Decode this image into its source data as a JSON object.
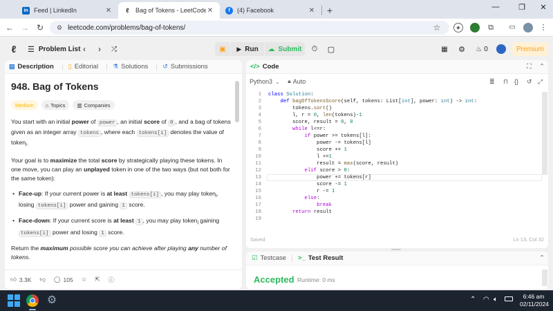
{
  "browser": {
    "tabs": [
      {
        "title": "Feed | LinkedIn",
        "favicon": "linkedin-icon",
        "color": "#0a66c2"
      },
      {
        "title": "Bag of Tokens - LeetCode",
        "favicon": "leetcode-icon",
        "color": "#ffa116"
      },
      {
        "title": "(4) Facebook",
        "favicon": "facebook-icon",
        "color": "#1877f2"
      }
    ],
    "url": "leetcode.com/problems/bag-of-tokens/"
  },
  "header": {
    "problem_list": "Problem List",
    "run": "Run",
    "submit": "Submit",
    "streak": "0",
    "premium": "Premium"
  },
  "left": {
    "tabs": [
      "Description",
      "Editorial",
      "Solutions",
      "Submissions"
    ],
    "title": "948. Bag of Tokens",
    "badges": [
      "Medium",
      "Topics",
      "Companies"
    ],
    "para1": {
      "a": "You start with an initial ",
      "b": "power",
      "c": " of ",
      "d": "power",
      "e": ", an initial ",
      "f": "score",
      "g": " of ",
      "h": "0",
      "i": ", and a bag of tokens given as an integer array ",
      "j": "tokens",
      "k": ", where each ",
      "l": "tokens[i]",
      "m": " denotes the value of token",
      "n": "i",
      "o": "."
    },
    "para2": {
      "a": "Your goal is to ",
      "b": "maximize",
      "c": " the total ",
      "d": "score",
      "e": " by strategically playing these tokens. In one move, you can play an ",
      "f": "unplayed",
      "g": " token in one of the two ways (but not both for the same token):"
    },
    "bullet1": {
      "a": "Face-up",
      "b": ": If your current power is ",
      "c": "at least",
      "d": " ",
      "e": "tokens[i]",
      "f": ", you may play token",
      "g": "i",
      "h": ", losing ",
      "i": "tokens[i]",
      "j": " power and gaining ",
      "k": "1",
      "l": " score."
    },
    "bullet2": {
      "a": "Face-down",
      "b": ": If your current score is ",
      "c": "at least",
      "d": " ",
      "e": "1",
      "f": ", you may play token",
      "g": "i",
      "h": " gaining ",
      "i": "tokens[i]",
      "j": " power and losing ",
      "k": "1",
      "l": " score."
    },
    "para3": {
      "a": "Return the ",
      "b": "maximum",
      "c": " possible score you can achieve after playing ",
      "d": "any",
      "e": " number of tokens."
    },
    "footer": {
      "likes": "3.3K",
      "comments": "105"
    }
  },
  "code": {
    "panel_title": "Code",
    "language": "Python3",
    "mode": "Auto",
    "line_numbers": [
      "1",
      "2",
      "3",
      "4",
      "5",
      "6",
      "7",
      "8",
      "9",
      "10",
      "11",
      "12",
      "13",
      "14",
      "15",
      "16",
      "17",
      "18",
      "19"
    ],
    "status": "Saved",
    "position": "Ln 13, Col 32"
  },
  "test": {
    "testcase": "Testcase",
    "result_tab": "Test Result",
    "status": "Accepted",
    "runtime": "Runtime: 0 ms"
  },
  "taskbar": {
    "time": "6:46 am",
    "date": "02/11/2024"
  }
}
